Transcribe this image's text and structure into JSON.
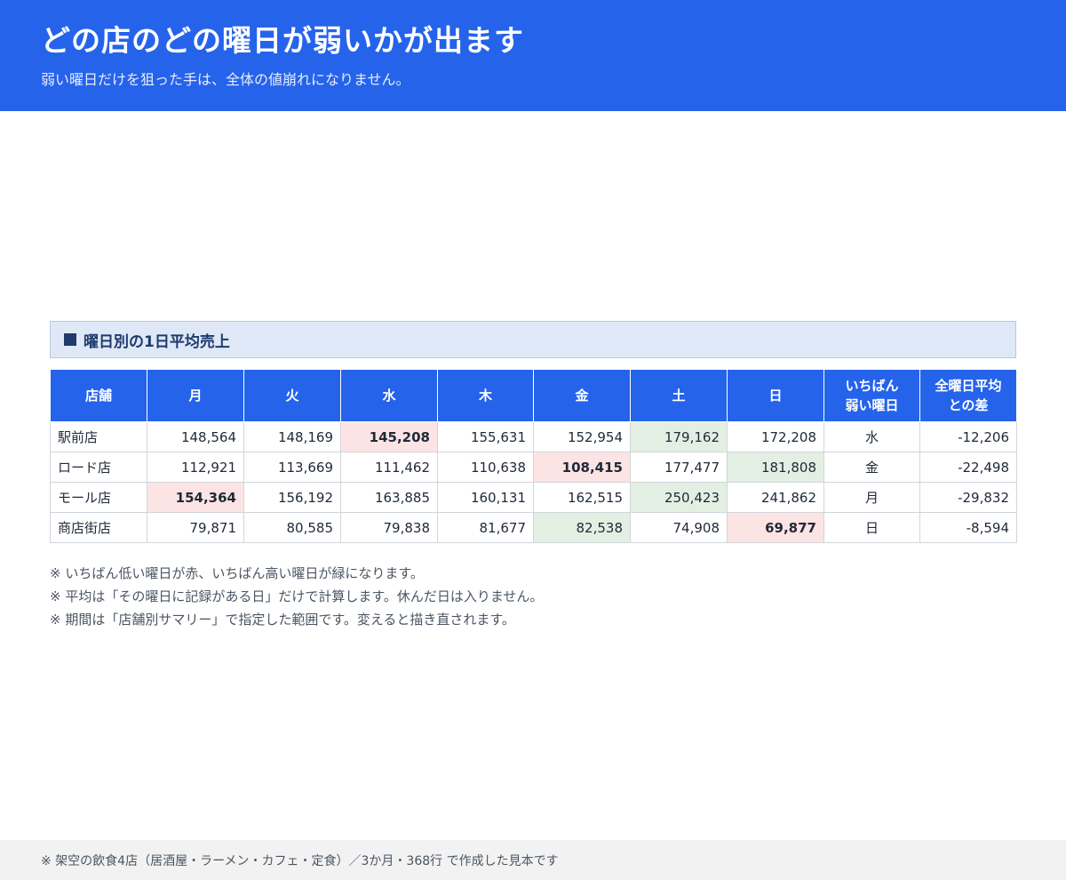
{
  "header": {
    "title": "どの店のどの曜日が弱いかが出ます",
    "subtitle": "弱い曜日だけを狙った手は、全体の値崩れになりません。"
  },
  "section": {
    "title": "曜日別の1日平均売上"
  },
  "table": {
    "columns": [
      "店舗",
      "月",
      "火",
      "水",
      "木",
      "金",
      "土",
      "日",
      "いちばん\n弱い曜日",
      "全曜日平均\nとの差"
    ],
    "rows": [
      {
        "store": "駅前店",
        "values": [
          "148,564",
          "148,169",
          "145,208",
          "155,631",
          "152,954",
          "179,162",
          "172,208"
        ],
        "lowest_index": 2,
        "highest_index": 5,
        "weakest_day": "水",
        "diff": "-12,206"
      },
      {
        "store": "ロード店",
        "values": [
          "112,921",
          "113,669",
          "111,462",
          "110,638",
          "108,415",
          "177,477",
          "181,808"
        ],
        "lowest_index": 4,
        "highest_index": 6,
        "weakest_day": "金",
        "diff": "-22,498"
      },
      {
        "store": "モール店",
        "values": [
          "154,364",
          "156,192",
          "163,885",
          "160,131",
          "162,515",
          "250,423",
          "241,862"
        ],
        "lowest_index": 0,
        "highest_index": 5,
        "weakest_day": "月",
        "diff": "-29,832"
      },
      {
        "store": "商店街店",
        "values": [
          "79,871",
          "80,585",
          "79,838",
          "81,677",
          "82,538",
          "74,908",
          "69,877"
        ],
        "lowest_index": 6,
        "highest_index": 4,
        "weakest_day": "日",
        "diff": "-8,594"
      }
    ]
  },
  "notes": [
    "※ いちばん低い曜日が赤、いちばん高い曜日が緑になります。",
    "※ 平均は「その曜日に記録がある日」だけで計算します。休んだ日は入りません。",
    "※ 期間は「店舗別サマリー」で指定した範囲です。変えると描き直されます。"
  ],
  "footer": {
    "text": "※ 架空の飲食4店（居酒屋・ラーメン・カフェ・定食）／3か月・368行 で作成した見本です"
  },
  "colors": {
    "accent": "#2563eb",
    "low_bg": "#fde4e4",
    "low_text": "#b91c1c",
    "high_bg": "#e3efe3"
  }
}
